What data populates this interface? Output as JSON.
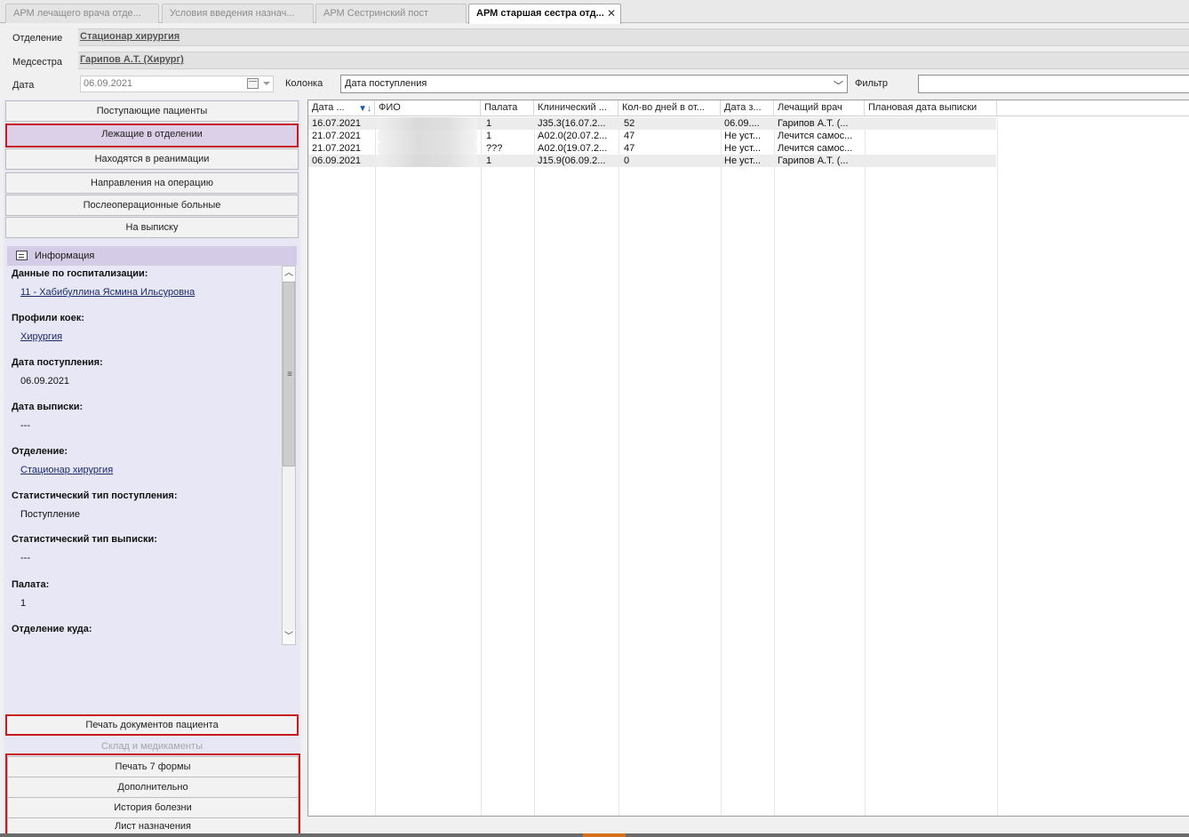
{
  "tabs": [
    {
      "label": "АРМ лечащего врача отде..."
    },
    {
      "label": "Условия введения назнач..."
    },
    {
      "label": "АРМ Сестринский пост"
    },
    {
      "label": "АРМ старшая сестра отд..."
    }
  ],
  "header": {
    "department_label": "Отделение",
    "department_value": "Стационар хирургия",
    "nurse_label": "Медсестра",
    "nurse_value": "Гарипов А.Т. (Хирург)",
    "date_label": "Дата",
    "date_value": "06.09.2021",
    "column_label": "Колонка",
    "column_value": "Дата поступления",
    "filter_label": "Фильтр",
    "filter_value": ""
  },
  "nav": {
    "incoming": "Поступающие пациенты",
    "in_department": "Лежащие в отделении",
    "icu": "Находятся в реанимации",
    "surgery_referrals": "Направления на операцию",
    "postop": "Послеоперационные больные",
    "discharge": "На выписку"
  },
  "info": {
    "title": "Информация",
    "fields": [
      {
        "label": "Данные по госпитализации:",
        "value": "11 - Хабибуллина Ясмина Ильсуровна",
        "link": true
      },
      {
        "label": "Профили коек:",
        "value": "Хирургия",
        "link": true
      },
      {
        "label": "Дата поступления:",
        "value": "06.09.2021",
        "link": false
      },
      {
        "label": "Дата выписки:",
        "value": "---",
        "link": false
      },
      {
        "label": "Отделение:",
        "value": "Стационар хирургия",
        "link": true
      },
      {
        "label": "Статистический тип поступления:",
        "value": "Поступление",
        "link": false
      },
      {
        "label": "Статистический тип выписки:",
        "value": "---",
        "link": false
      },
      {
        "label": "Палата:",
        "value": "1",
        "link": false
      },
      {
        "label": "Отделение куда:",
        "value": "",
        "link": false
      }
    ]
  },
  "actions": {
    "print_docs": "Печать документов пациента",
    "warehouse": "Склад и медикаменты",
    "print_form7": "Печать 7 формы",
    "additional": "Дополнительно",
    "history": "История болезни",
    "prescriptions": "Лист назначения"
  },
  "grid": {
    "columns": [
      "Дата ...",
      "ФИО",
      "Палата",
      "Клинический ...",
      "Кол-во дней в от...",
      "Дата з...",
      "Лечащий врач",
      "Плановая дата выписки"
    ],
    "rows": [
      [
        "16.07.2021",
        "",
        "1",
        "J35.3(16.07.2...",
        "52",
        "06.09....",
        "Гарипов А.Т. (...",
        ""
      ],
      [
        "21.07.2021",
        "",
        "1",
        "A02.0(20.07.2...",
        "47",
        "Не уст...",
        "Лечится самос...",
        ""
      ],
      [
        "21.07.2021",
        "",
        "???",
        "A02.0(19.07.2...",
        "47",
        "Не уст...",
        "Лечится самос...",
        ""
      ],
      [
        "06.09.2021",
        "",
        "1",
        "J15.9(06.09.2...",
        "0",
        "Не уст...",
        "Гарипов А.Т. (...",
        ""
      ]
    ]
  }
}
